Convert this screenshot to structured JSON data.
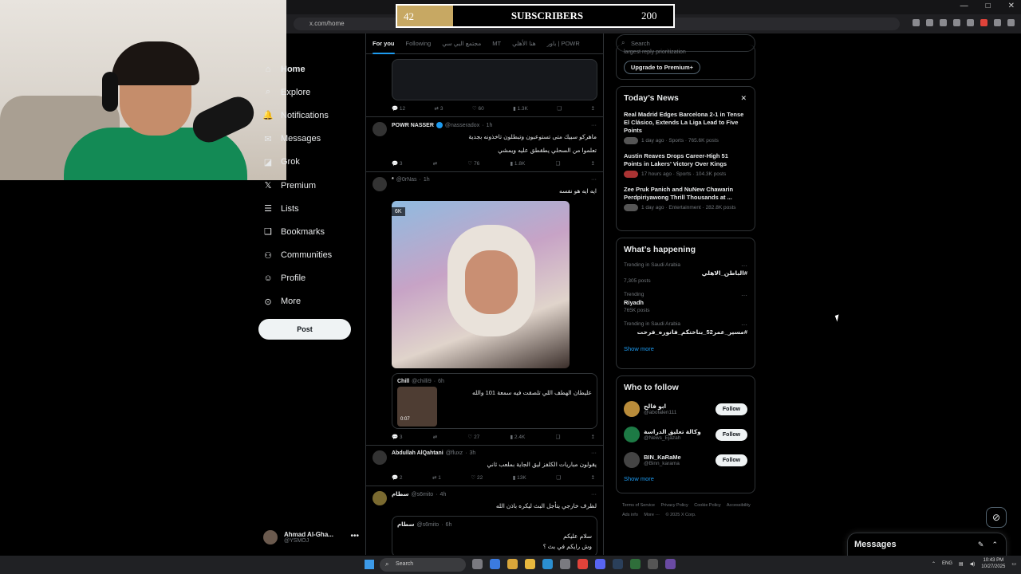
{
  "browser": {
    "url": "x.com/home",
    "window_controls": [
      "—",
      "□",
      "✕"
    ]
  },
  "subscribers": {
    "current": "42",
    "label": "SUBSCRIBERS",
    "goal": "200"
  },
  "nav": {
    "items": [
      {
        "icon": "home-icon",
        "glyph": "⌂",
        "label": "Home"
      },
      {
        "icon": "explore-icon",
        "glyph": "⌕",
        "label": "Explore"
      },
      {
        "icon": "notifications-icon",
        "glyph": "🔔",
        "label": "Notifications"
      },
      {
        "icon": "messages-icon",
        "glyph": "✉",
        "label": "Messages"
      },
      {
        "icon": "grok-icon",
        "glyph": "◪",
        "label": "Grok"
      },
      {
        "icon": "premium-icon",
        "glyph": "𝕏",
        "label": "Premium"
      },
      {
        "icon": "lists-icon",
        "glyph": "☰",
        "label": "Lists"
      },
      {
        "icon": "bookmarks-icon",
        "glyph": "❑",
        "label": "Bookmarks"
      },
      {
        "icon": "communities-icon",
        "glyph": "⚇",
        "label": "Communities"
      },
      {
        "icon": "profile-icon",
        "glyph": "☺",
        "label": "Profile"
      },
      {
        "icon": "more-icon",
        "glyph": "⊙",
        "label": "More"
      }
    ],
    "post_label": "Post",
    "account": {
      "name": "Ahmad Al-Gha...",
      "handle": "@YSMOJ",
      "more": "•••"
    }
  },
  "timeline": {
    "tabs": [
      "For you",
      "Following",
      "مجتمع البي سي",
      "MT",
      "هنا الأهلي",
      "باور | POWR"
    ],
    "tweets": [
      {
        "kind": "card",
        "stats": {
          "replies": "12",
          "retweets": "3",
          "likes": "60",
          "views": "1.3K"
        }
      },
      {
        "name": "POWR NASSER",
        "handle": "@nasseradox",
        "time": "1h",
        "text": "ماهركو سبيك متى تستوعبون وتبطلون تاخذونه بجدية",
        "text2": "تعلموا من السحلي يطقطق عليه ويمشي",
        "stats": {
          "replies": "3",
          "retweets": "",
          "likes": "76",
          "views": "1.8K"
        }
      },
      {
        "name": "*",
        "handle": "@0rNas",
        "time": "1h",
        "text": "ايه ايه هو نفسه",
        "media_badge": "6K",
        "quote": {
          "name": "Chill",
          "handle": "@chilli9",
          "time": "6h",
          "text": "عليطان الهطف اللي تلصقت فيه سمعة 101 والله",
          "duration": "0:07"
        },
        "stats": {
          "replies": "3",
          "retweets": "",
          "likes": "27",
          "views": "2.4K"
        }
      },
      {
        "name": "Abdullah AlQahtani",
        "handle": "@fluxz",
        "time": "3h",
        "text": "يقولون مباريات الكلفز ليق الجاية بملعب ثاني",
        "stats": {
          "replies": "2",
          "retweets": "1",
          "likes": "22",
          "views": "13K"
        }
      },
      {
        "name": "سطام",
        "handle": "@s6mito",
        "time": "4h",
        "text": "لظرف خارجي يتأجل البث ليكره باذن الله",
        "quote": {
          "name": "سطام",
          "handle": "@s6mito",
          "time": "6h",
          "text": "سلام عليكم",
          "text2": "وش رايكم في بث ؟"
        }
      }
    ]
  },
  "right": {
    "search_placeholder": "Search",
    "premium_subtext": "largest reply prioritization",
    "premium_button": "Upgrade to Premium+",
    "news": {
      "title": "Today’s News",
      "items": [
        {
          "title": "Real Madrid Edges Barcelona 2-1 in Tense El Clásico, Extends La Liga Lead to Five Points",
          "meta": "1 day ago · Sports · 765.6K posts"
        },
        {
          "title": "Austin Reaves Drops Career-High 51 Points in Lakers’ Victory Over Kings",
          "meta": "17 hours ago · Sports · 104.3K posts"
        },
        {
          "title": "Zee Pruk Panich and NuNew Chawarin Perdpiriyawong Thrill Thousands at ...",
          "meta": "1 day ago · Entertainment · 282.8K posts"
        }
      ]
    },
    "happening": {
      "title": "What’s happening",
      "trends": [
        {
          "context": "Trending in Saudi Arabia",
          "name": "#الباطن_الاهلي",
          "count": "7,305 posts",
          "rtl": true
        },
        {
          "context": "Trending",
          "name": "Riyadh",
          "count": "765K posts",
          "rtl": false
        },
        {
          "context": "Trending in Saudi Arabia",
          "name": "#مسير_عمر52_بناختكم_فانوره_فرحت",
          "count": "",
          "rtl": true
        }
      ],
      "show_more": "Show more"
    },
    "who_to_follow": {
      "title": "Who to follow",
      "people": [
        {
          "name": "ابو فالح",
          "handle": "@abofalen111",
          "button": "Follow"
        },
        {
          "name": "وكالة تعليق الدراسة",
          "handle": "@News_Ejazah",
          "button": "Follow"
        },
        {
          "name": "BIN_KaRaMe",
          "handle": "@Binn_karama",
          "button": "Follow"
        }
      ],
      "show_more": "Show more"
    },
    "footer": [
      "Terms of Service",
      "Privacy Policy",
      "Cookie Policy",
      "Accessibility",
      "Ads info",
      "More ···",
      "© 2025 X Corp."
    ]
  },
  "messages_bar": {
    "label": "Messages"
  },
  "taskbar": {
    "search_placeholder": "Search",
    "lang": "ENG",
    "time": "10:43 PM",
    "date": "10/27/2025"
  },
  "colors": {
    "accent": "#1d9bf0",
    "banner_gold": "#c7a863",
    "background": "#000000"
  }
}
